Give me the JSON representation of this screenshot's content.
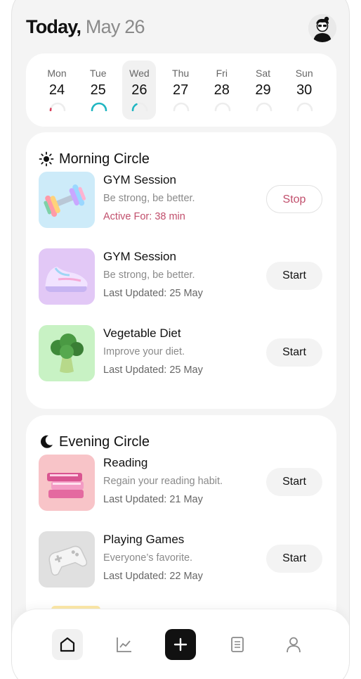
{
  "header": {
    "today": "Today,",
    "date": "May 26"
  },
  "week": [
    {
      "name": "Mon",
      "num": "24",
      "progress": 0.08,
      "color": "#d9405c"
    },
    {
      "name": "Tue",
      "num": "25",
      "progress": 1.0,
      "color": "#1fb6c2"
    },
    {
      "name": "Wed",
      "num": "26",
      "progress": 0.35,
      "color": "#1fb6c2",
      "selected": true
    },
    {
      "name": "Thu",
      "num": "27",
      "progress": 0,
      "color": "#1fb6c2"
    },
    {
      "name": "Fri",
      "num": "28",
      "progress": 0,
      "color": "#1fb6c2"
    },
    {
      "name": "Sat",
      "num": "29",
      "progress": 0,
      "color": "#1fb6c2"
    },
    {
      "name": "Sun",
      "num": "30",
      "progress": 0,
      "color": "#1fb6c2"
    }
  ],
  "morning": {
    "title": "Morning Circle",
    "items": [
      {
        "name": "GYM Session",
        "desc": "Be strong, be better.",
        "meta": "Active For: 38 min",
        "button": "Stop",
        "thumb_color": "#cdebf9",
        "icon": "dumbbell-icon"
      },
      {
        "name": "GYM Session",
        "desc": "Be strong, be better.",
        "meta": "Last Updated: 25 May",
        "button": "Start",
        "thumb_color": "#e2c8f6",
        "icon": "sneaker-icon"
      },
      {
        "name": "Vegetable Diet",
        "desc": "Improve your diet.",
        "meta": "Last Updated: 25 May",
        "button": "Start",
        "thumb_color": "#c8f2c4",
        "icon": "broccoli-icon"
      }
    ]
  },
  "evening": {
    "title": "Evening Circle",
    "items": [
      {
        "name": "Reading",
        "desc": "Regain your reading habit.",
        "meta": "Last Updated: 21 May",
        "button": "Start",
        "thumb_color": "#f8c4c8",
        "icon": "books-icon"
      },
      {
        "name": "Playing Games",
        "desc": "Everyone’s favorite.",
        "meta": "Last Updated: 22 May",
        "button": "Start",
        "thumb_color": "#e0e0e0",
        "icon": "gamepad-icon"
      }
    ]
  },
  "accent_active": "#c14f6c",
  "tabs": [
    "home-icon",
    "chart-icon",
    "plus-icon",
    "notes-icon",
    "profile-icon"
  ]
}
